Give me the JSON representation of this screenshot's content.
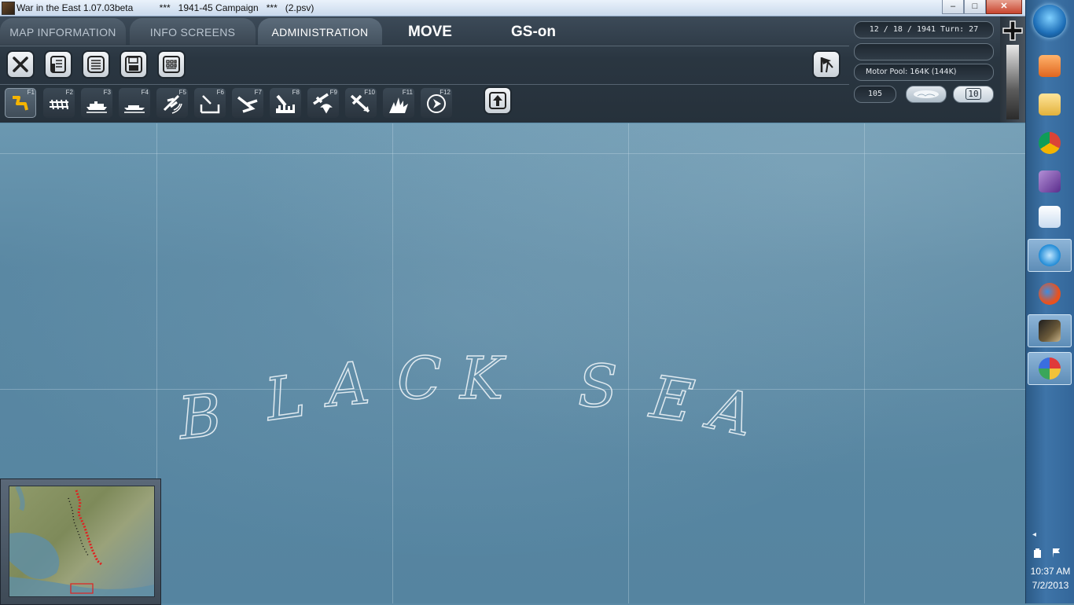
{
  "window": {
    "title": "War in the East 1.07.03beta          ***   1941-45 Campaign   ***   (2.psv)",
    "minimize": "–",
    "maximize": "□",
    "close": "✕"
  },
  "tabs": [
    {
      "label": "MAP INFORMATION"
    },
    {
      "label": "INFO SCREENS"
    },
    {
      "label": "ADMINISTRATION"
    }
  ],
  "mode": {
    "move": "MOVE",
    "gs": "GS-on"
  },
  "toolbar": {
    "buttons": [
      {
        "icon": "close-icon"
      },
      {
        "icon": "report-icon"
      },
      {
        "icon": "list-icon"
      },
      {
        "icon": "save-icon"
      },
      {
        "icon": "grid-icon"
      }
    ],
    "surrender_icon": "flag-icon"
  },
  "commands": [
    {
      "key": "F1",
      "icon": "move-mode-icon"
    },
    {
      "key": "F2",
      "icon": "rail-icon"
    },
    {
      "key": "F3",
      "icon": "naval-transport-icon"
    },
    {
      "key": "F4",
      "icon": "amphibious-icon"
    },
    {
      "key": "F5",
      "icon": "air-recon-icon"
    },
    {
      "key": "F6",
      "icon": "airbase-icon"
    },
    {
      "key": "F7",
      "icon": "air-transfer-icon"
    },
    {
      "key": "F8",
      "icon": "city-bomb-icon"
    },
    {
      "key": "F9",
      "icon": "paradrop-icon"
    },
    {
      "key": "F10",
      "icon": "air-attack-icon"
    },
    {
      "key": "F11",
      "icon": "explosion-icon"
    },
    {
      "key": "F12",
      "icon": "end-turn-icon"
    }
  ],
  "upload_icon": "up-arrow-icon",
  "status": {
    "date": "12 / 18 / 1941     Turn: 27",
    "empty": "",
    "motor_pool": "Motor Pool:  164K (144K)",
    "number": "105",
    "capital": "10"
  },
  "map": {
    "label_letters": [
      "B",
      "L",
      "A",
      "C",
      "K",
      "S",
      "E",
      "A"
    ]
  },
  "taskbar": {
    "time": "10:37 AM",
    "date": "7/2/2013",
    "tray_arrow": "◂",
    "items": [
      {
        "icon": "media-player-icon"
      },
      {
        "icon": "folder-icon"
      },
      {
        "icon": "chrome-icon"
      },
      {
        "icon": "visual-studio-icon"
      },
      {
        "icon": "wordpad-icon"
      },
      {
        "icon": "ie-icon"
      },
      {
        "icon": "firefox-icon"
      },
      {
        "icon": "war-in-the-east-icon"
      },
      {
        "icon": "paint-icon"
      }
    ]
  },
  "colors": {
    "sea": "#5b8aa6",
    "header": "#2a3641",
    "front_line": "#e02020"
  }
}
